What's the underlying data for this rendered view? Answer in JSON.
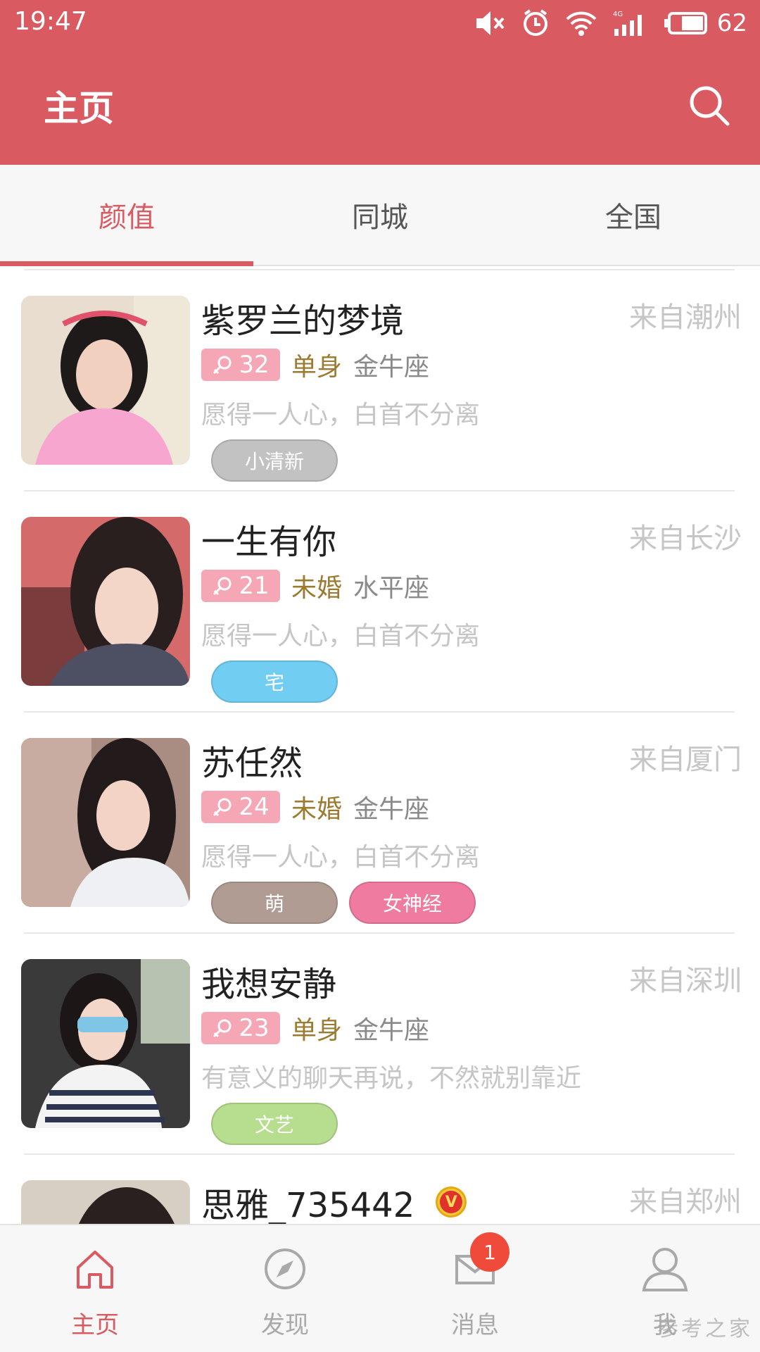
{
  "status_bar": {
    "time": "19:47",
    "battery": "62"
  },
  "header": {
    "title": "主页",
    "search_icon": "search-icon"
  },
  "tabs": [
    {
      "label": "颜值",
      "active": true
    },
    {
      "label": "同城",
      "active": false
    },
    {
      "label": "全国",
      "active": false
    }
  ],
  "profiles": [
    {
      "name": "紫罗兰的梦境",
      "city": "来自潮州",
      "age": "32",
      "status": "单身",
      "zodiac": "金牛座",
      "signature": "愿得一人心，白首不分离",
      "tags": [
        {
          "label": "小清新",
          "color": "#c2c2c2"
        }
      ]
    },
    {
      "name": "一生有你",
      "city": "来自长沙",
      "age": "21",
      "status": "未婚",
      "zodiac": "水平座",
      "signature": "愿得一人心，白首不分离",
      "tags": [
        {
          "label": "宅",
          "color": "#72cdf3"
        }
      ]
    },
    {
      "name": "苏任然",
      "city": "来自厦门",
      "age": "24",
      "status": "未婚",
      "zodiac": "金牛座",
      "signature": "愿得一人心，白首不分离",
      "tags": [
        {
          "label": "萌",
          "color": "#b09c92"
        },
        {
          "label": "女神经",
          "color": "#ef7ba1"
        }
      ]
    },
    {
      "name": "我想安静",
      "city": "来自深圳",
      "age": "23",
      "status": "单身",
      "zodiac": "金牛座",
      "signature": "有意义的聊天再说，不然就别靠近",
      "tags": [
        {
          "label": "文艺",
          "color": "#b7dd8e"
        }
      ]
    },
    {
      "name": "思雅_735442",
      "city": "来自郑州",
      "vip": true,
      "vip_glyph": "V"
    }
  ],
  "bottom_nav": [
    {
      "label": "主页",
      "icon": "home-icon",
      "active": true
    },
    {
      "label": "发现",
      "icon": "compass-icon",
      "active": false
    },
    {
      "label": "消息",
      "icon": "mail-icon",
      "active": false,
      "badge": "1"
    },
    {
      "label": "我",
      "icon": "user-icon",
      "active": false
    }
  ],
  "watermark": "参考之家",
  "colors": {
    "brand": "#d95a60",
    "age_badge": "#f6a7b6",
    "status_text": "#9c7a2f"
  }
}
